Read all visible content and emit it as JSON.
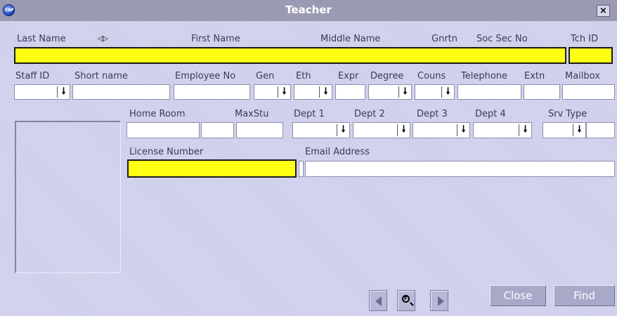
{
  "window": {
    "title": "Teacher",
    "close_glyph": "×",
    "app_icon_text": "CAP"
  },
  "row1": {
    "labels": {
      "last_name": "Last Name",
      "first_name": "First Name",
      "middle_name": "Middle Name",
      "gnrtn": "Gnrtn",
      "soc_sec_no": "Soc Sec No",
      "tch_id": "Tch ID"
    },
    "sort_glyph": "◁▷",
    "name_value": "",
    "tch_id_value": ""
  },
  "row2": {
    "labels": {
      "staff_id": "Staff ID",
      "short_name": "Short name",
      "employee_no": "Employee No",
      "gen": "Gen",
      "eth": "Eth",
      "expr": "Expr",
      "degree": "Degree",
      "couns": "Couns",
      "telephone": "Telephone",
      "extn": "Extn",
      "mailbox": "Mailbox"
    }
  },
  "row3": {
    "labels": {
      "home_room": "Home Room",
      "maxstu": "MaxStu",
      "dept1": "Dept 1",
      "dept2": "Dept 2",
      "dept3": "Dept 3",
      "dept4": "Dept 4",
      "srv_type": "Srv Type"
    }
  },
  "row4": {
    "labels": {
      "license_number": "License Number",
      "email_address": "Email Address"
    }
  },
  "dropdown_arrow": "🠗",
  "buttons": {
    "close": "Close",
    "find": "Find"
  },
  "icons": {
    "prev": "triangle-left-icon",
    "lookup": "magnifier-icon",
    "next": "triangle-right-icon",
    "dropdown": "down-arrow-icon"
  }
}
